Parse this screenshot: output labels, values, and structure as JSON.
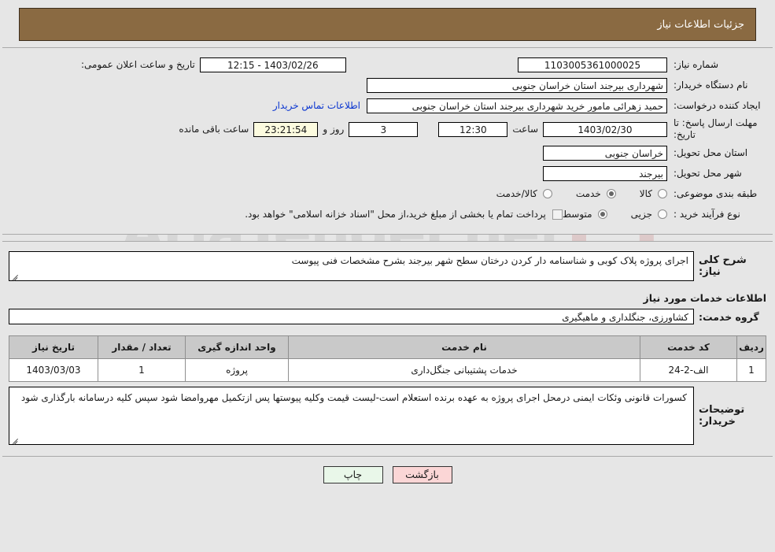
{
  "header": {
    "title": "جزئیات اطلاعات نیاز"
  },
  "watermark": {
    "text": "AriaTender.net"
  },
  "form": {
    "need_number_label": "شماره نیاز:",
    "need_number_value": "1103005361000025",
    "announce_label": "تاریخ و ساعت اعلان عمومی:",
    "announce_value": "1403/02/26 - 12:15",
    "buyer_org_label": "نام دستگاه خریدار:",
    "buyer_org_value": "شهرداری بیرجند استان خراسان جنوبی",
    "creator_label": "ایجاد کننده درخواست:",
    "creator_value": "حمید زهرائی مامور خرید شهرداری بیرجند استان خراسان جنوبی",
    "contact_link": "اطلاعات تماس خریدار",
    "deadline_label": "مهلت ارسال پاسخ: تا تاریخ:",
    "deadline_date": "1403/02/30",
    "hour_label": "ساعت",
    "deadline_time": "12:30",
    "days_value": "3",
    "days_text": "روز و",
    "countdown_value": "23:21:54",
    "countdown_text": "ساعت باقی مانده",
    "province_label": "استان محل تحویل:",
    "province_value": "خراسان جنوبی",
    "city_label": "شهر محل تحویل:",
    "city_value": "بیرجند",
    "category_label": "طبقه بندی موضوعی:",
    "category_options": [
      {
        "label": "کالا",
        "selected": false
      },
      {
        "label": "خدمت",
        "selected": true
      },
      {
        "label": "کالا/خدمت",
        "selected": false
      }
    ],
    "process_label": "نوع فرآیند خرید :",
    "process_options": [
      {
        "label": "جزیی",
        "selected": false
      },
      {
        "label": "متوسط",
        "selected": true
      }
    ],
    "treasury_checkbox_label": "پرداخت تمام یا بخشی از مبلغ خرید،از محل \"اسناد خزانه اسلامی\" خواهد بود.",
    "treasury_checked": false
  },
  "description": {
    "label": "شرح کلی نیاز:",
    "value": "اجرای پروژه پلاک کوبی و شناسنامه دار کردن درختان سطح شهر بیرجند بشرح مشخصات فنی پیوست"
  },
  "services": {
    "heading": "اطلاعات خدمات مورد نیاز",
    "group_label": "گروه خدمت:",
    "group_value": "کشاورزی، جنگلداری و ماهیگیری",
    "columns": [
      "ردیف",
      "کد خدمت",
      "نام خدمت",
      "واحد اندازه گیری",
      "تعداد / مقدار",
      "تاریخ نیاز"
    ],
    "rows": [
      {
        "radif": "1",
        "code": "الف-2-24",
        "name": "خدمات پشتیبانی جنگل‌داری",
        "unit": "پروژه",
        "qty": "1",
        "date": "1403/03/03"
      }
    ]
  },
  "notes": {
    "label": "توضیحات خریدار:",
    "value": "کسورات قانونی وئکات ایمنی درمحل اجرای پروژه به عهده برنده استعلام است-لیست قیمت وکلیه پیوستها پس ازتکمیل مهروامضا شود سپس کلیه درسامانه بارگذاری شود"
  },
  "footer": {
    "print_label": "چاپ",
    "back_label": "بازگشت"
  }
}
